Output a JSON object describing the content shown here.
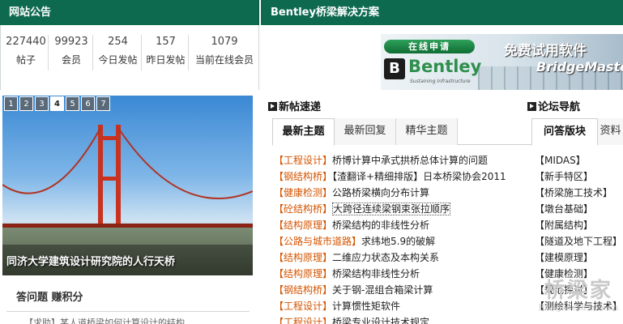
{
  "header": {
    "left_title": "网站公告",
    "right_title": "Bentley桥梁解决方案"
  },
  "stats": [
    {
      "value": "227440",
      "label": "帖子"
    },
    {
      "value": "99923",
      "label": "会员"
    },
    {
      "value": "254",
      "label": "今日发帖"
    },
    {
      "value": "157",
      "label": "昨日发帖"
    },
    {
      "value": "1079",
      "label": "当前在线会员"
    }
  ],
  "banner": {
    "apply_button": "在线申请",
    "trial_text": "免费试用软件",
    "product_text": "BridgeMaster",
    "brand": "Bentley",
    "brand_logo": "B",
    "tagline": "Sustaining Infrastructure"
  },
  "slider": {
    "pages": [
      "1",
      "2",
      "3",
      "4",
      "5",
      "6",
      "7"
    ],
    "active_page": "4",
    "caption": "同济大学建筑设计研究院的人行天桥"
  },
  "qa": {
    "title": "答问题 赚积分",
    "subtitle": "【求助】某人道桥梁如何计算设计的结构"
  },
  "sections": {
    "new_posts": "新帖速递",
    "forum_nav": "论坛导航"
  },
  "tabs": [
    {
      "label": "最新主题",
      "active": true
    },
    {
      "label": "最新回复",
      "active": false
    },
    {
      "label": "精华主题",
      "active": false
    },
    {
      "label": "问答版块",
      "active": true
    },
    {
      "label": "资料",
      "active": false
    }
  ],
  "posts": [
    {
      "category": "【工程设计】",
      "title": "桥博计算中承式拱桥总体计算的问题"
    },
    {
      "category": "【钢结构桥】",
      "title": "【渣翻译+精细排版】日本桥梁协会2011"
    },
    {
      "category": "【健康检测】",
      "title": "公路桥梁横向分布计算"
    },
    {
      "category": "【砼结构桥】",
      "title": "大跨径连续梁钢束张拉顺序",
      "highlight": true
    },
    {
      "category": "【结构原理】",
      "title": "桥梁结构的非线性分析"
    },
    {
      "category": "【公路与城市道路】",
      "title": "求纬地5.9的破解"
    },
    {
      "category": "【结构原理】",
      "title": "二维应力状态及本构关系"
    },
    {
      "category": "【结构原理】",
      "title": "桥梁结构非线性分析"
    },
    {
      "category": "【钢结构桥】",
      "title": "关于钢-混组合箱梁计算"
    },
    {
      "category": "【工程设计】",
      "title": "计算惯性矩软件"
    },
    {
      "category": "【工程设计】",
      "title": "桥梁专业设计技术规定"
    }
  ],
  "boards": [
    "【MIDAS】",
    "【新手特区】",
    "【桥梁施工技术】",
    "【墩台基础】",
    "【附属结构】",
    "【隧道及地下工程】",
    "【建模原理】",
    "【健康检测】",
    "【规范探讨】",
    "【测绘科学与技术】"
  ],
  "watermark": {
    "text": "桥梁家",
    "url": "Bridgehead.com.cn"
  }
}
